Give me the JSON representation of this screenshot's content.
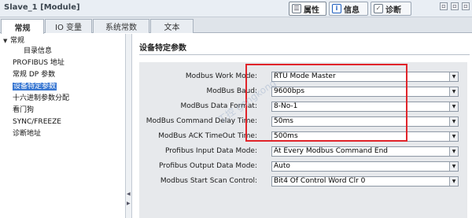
{
  "window": {
    "title": "Slave_1 [Module]",
    "panel_tabs": [
      {
        "label": "属性",
        "icon": "properties-icon",
        "active": true
      },
      {
        "label": "信息",
        "icon": "info-icon",
        "active": false
      },
      {
        "label": "诊断",
        "icon": "diagnostics-icon",
        "active": false
      }
    ],
    "controls": [
      "▫",
      "▫",
      "▫"
    ]
  },
  "tabs": [
    "常规",
    "IO 变量",
    "系统常数",
    "文本"
  ],
  "nav": {
    "items": [
      {
        "label": "常规",
        "level": 0,
        "expanded": true
      },
      {
        "label": "目录信息",
        "level": 1
      },
      {
        "label": "PROFIBUS 地址",
        "level": 0
      },
      {
        "label": "常规 DP 参数",
        "level": 0
      },
      {
        "label": "设备特定参数",
        "level": 0,
        "selected": true
      },
      {
        "label": "十六进制参数分配",
        "level": 0
      },
      {
        "label": "看门狗",
        "level": 0
      },
      {
        "label": "SYNC/FREEZE",
        "level": 0
      },
      {
        "label": "诊断地址",
        "level": 0
      }
    ]
  },
  "main": {
    "section_title": "设备特定参数",
    "params": [
      {
        "label": "Modbus Work Mode:",
        "value": "RTU Mode Master"
      },
      {
        "label": "ModBus Baud:",
        "value": "9600bps"
      },
      {
        "label": "ModBus Data Format:",
        "value": "8-No-1"
      },
      {
        "label": "ModBus Command Delay Time:",
        "value": "50ms"
      },
      {
        "label": "ModBus ACK TimeOut Time:",
        "value": "500ms"
      },
      {
        "label": "Profibus Input Data Mode:",
        "value": "At Every Modbus Command End"
      },
      {
        "label": "Profibus Output Data Mode:",
        "value": "Auto"
      },
      {
        "label": "Modbus Start Scan Control:",
        "value": "Bit4 Of Control Word Clr 0"
      }
    ]
  },
  "watermark": "工控 gongkong",
  "colors": {
    "accent": "#3877d2",
    "highlight": "#e0242a"
  }
}
